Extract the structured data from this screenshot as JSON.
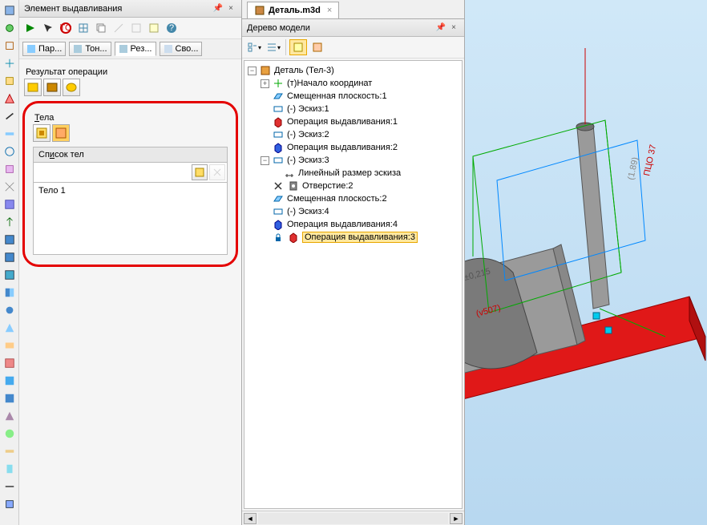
{
  "left_panel": {
    "title": "Элемент выдавливания",
    "tabs": [
      {
        "label": "Пар..."
      },
      {
        "label": "Тон..."
      },
      {
        "label": "Рез...",
        "active": true
      },
      {
        "label": "Сво..."
      }
    ],
    "section_result": "Результат операции",
    "section_bodies": "Тела",
    "list_header": "Список тел",
    "list_items": [
      "Тело 1"
    ]
  },
  "mid_panel": {
    "doc_tab": "Деталь.m3d",
    "tree_header": "Дерево модели",
    "tree": [
      {
        "level": 0,
        "exp": "-",
        "icon": "part",
        "label": "Деталь (Тел-3)"
      },
      {
        "level": 1,
        "exp": "+",
        "icon": "axis",
        "label": "(т)Начало координат"
      },
      {
        "level": 1,
        "exp": "",
        "icon": "plane",
        "label": "Смещенная плоскость:1"
      },
      {
        "level": 1,
        "exp": "",
        "icon": "sketch",
        "label": "(-) Эскиз:1"
      },
      {
        "level": 1,
        "exp": "",
        "icon": "extrude",
        "label": "Операция выдавливания:1"
      },
      {
        "level": 1,
        "exp": "",
        "icon": "sketch",
        "label": "(-) Эскиз:2"
      },
      {
        "level": 1,
        "exp": "",
        "icon": "extrude2",
        "label": "Операция выдавливания:2"
      },
      {
        "level": 1,
        "exp": "-",
        "icon": "sketch",
        "label": "(-) Эскиз:3"
      },
      {
        "level": 2,
        "exp": "",
        "icon": "dim",
        "label": "Линейный размер эскиза"
      },
      {
        "level": 1,
        "exp": "",
        "icon": "hole",
        "label": "Отверстие:2",
        "struck": true
      },
      {
        "level": 1,
        "exp": "",
        "icon": "plane",
        "label": "Смещенная плоскость:2"
      },
      {
        "level": 1,
        "exp": "",
        "icon": "sketch",
        "label": "(-) Эскиз:4"
      },
      {
        "level": 1,
        "exp": "",
        "icon": "extrude2",
        "label": "Операция выдавливания:4"
      },
      {
        "level": 1,
        "exp": "",
        "icon": "extrude",
        "label": "Операция выдавливания:3",
        "selected": true,
        "lock": true
      }
    ]
  },
  "viewport": {
    "annotation_v507": "(v507)",
    "annotation_0215": "±0,215",
    "annotation_right1": "ПЦО 37",
    "annotation_right2": "(1.89 )"
  }
}
